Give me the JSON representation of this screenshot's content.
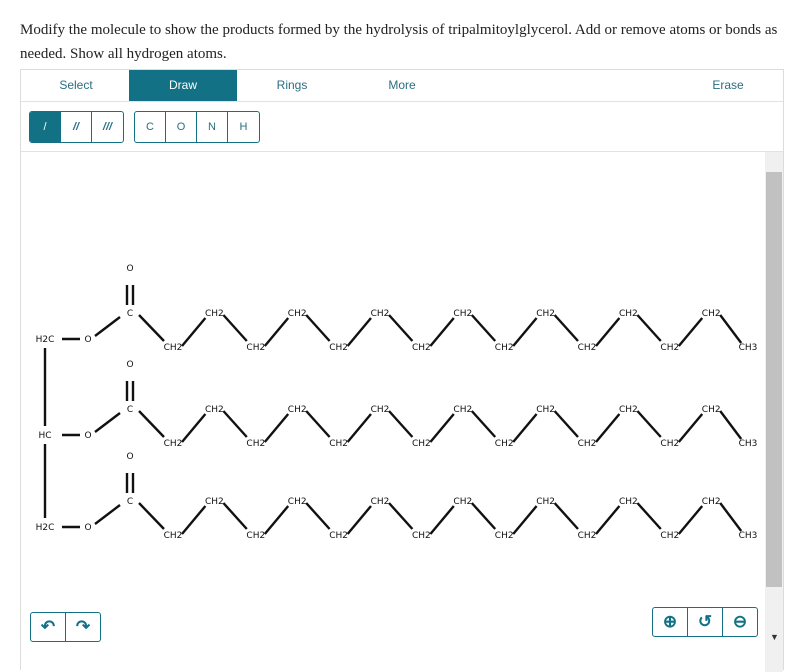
{
  "question": "Modify the molecule to show the products formed by the hydrolysis of tripalmitoylglycerol. Add or remove atoms or bonds as needed. Show all hydrogen atoms.",
  "tabs": [
    {
      "label": "Select"
    },
    {
      "label": "Draw",
      "active": true
    },
    {
      "label": "Rings"
    },
    {
      "label": "More"
    },
    {
      "label": "Erase"
    }
  ],
  "bond_tools": [
    {
      "icon": "single-bond-icon",
      "glyph": "/",
      "selected": true
    },
    {
      "icon": "double-bond-icon",
      "glyph": "//"
    },
    {
      "icon": "triple-bond-icon",
      "glyph": "///"
    }
  ],
  "atom_tools": [
    "C",
    "O",
    "N",
    "H"
  ],
  "molecule": {
    "glycerol": [
      "H2C",
      "HC",
      "H2C"
    ],
    "ester_oxygen": "O",
    "carbonyl_oxygen": "O",
    "carbonyl_carbon": "C",
    "chain_ch2": "CH2",
    "chain_ch2_count": 14,
    "chain_end": "CH3",
    "chains": 3
  },
  "bottom": {
    "undo_icon": "undo-icon",
    "redo_icon": "redo-icon",
    "zoom_in_icon": "zoom-in-icon",
    "reset_zoom_icon": "reset-zoom-icon",
    "zoom_out_icon": "zoom-out-icon"
  },
  "colors": {
    "accent": "#137186"
  }
}
